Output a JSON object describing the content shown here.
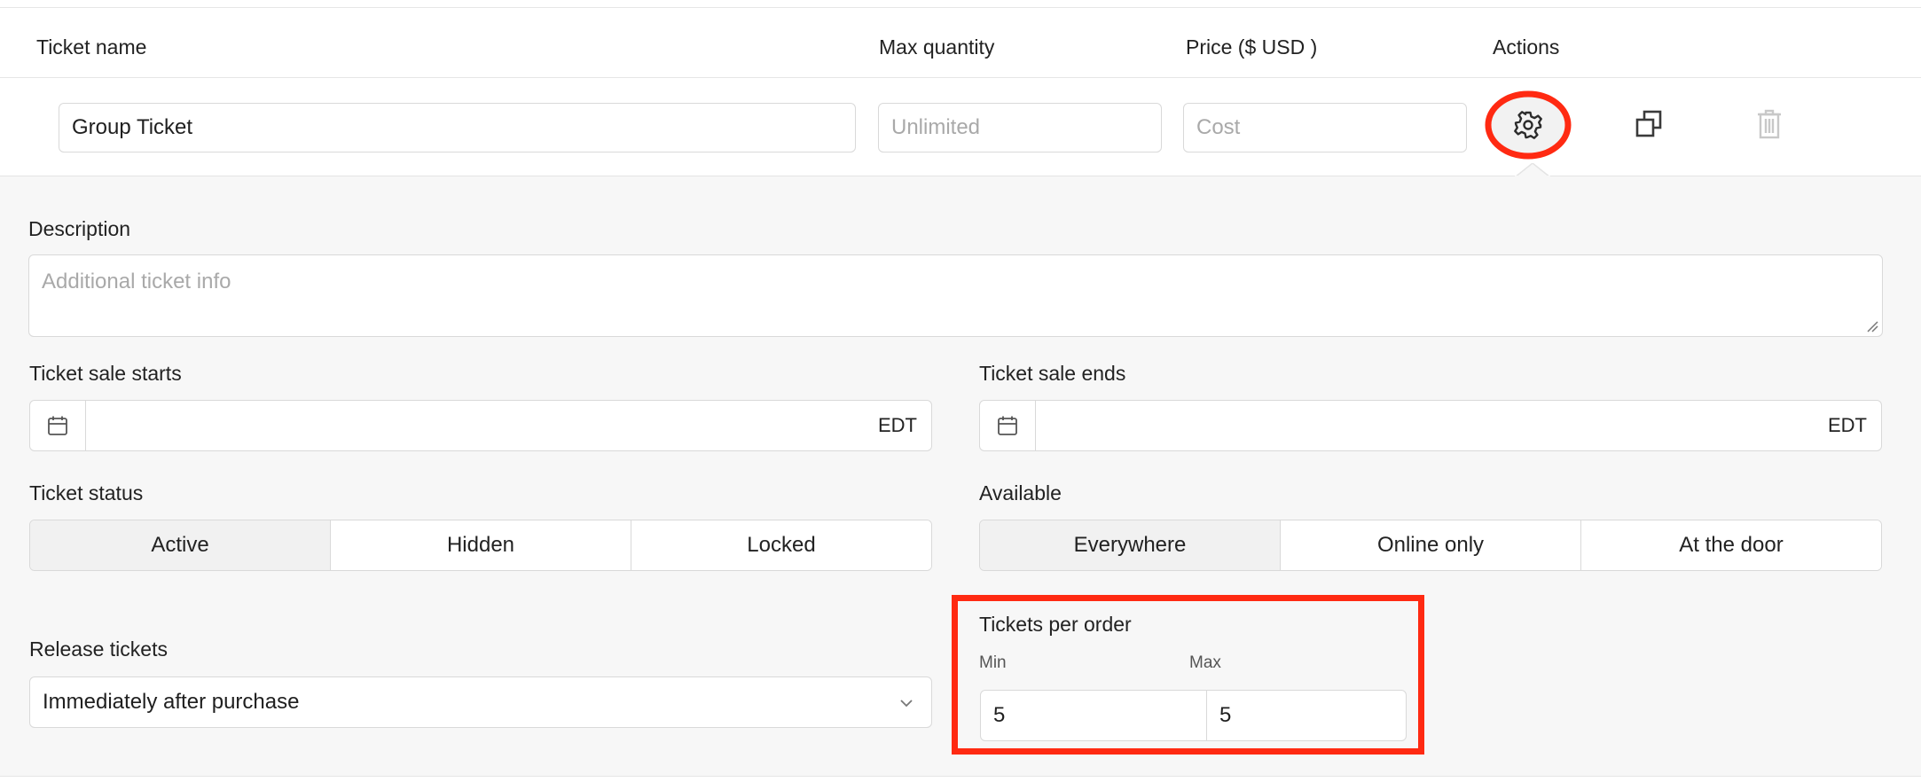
{
  "columns": {
    "ticket_name": "Ticket name",
    "max_quantity": "Max quantity",
    "price": "Price ($ USD )",
    "actions": "Actions"
  },
  "ticket_row": {
    "name_value": "Group Ticket",
    "max_quantity_placeholder": "Unlimited",
    "cost_placeholder": "Cost",
    "action_icons": [
      "gear-icon",
      "duplicate-icon",
      "trash-icon"
    ]
  },
  "settings": {
    "description_label": "Description",
    "description_placeholder": "Additional ticket info",
    "sale_starts_label": "Ticket sale starts",
    "sale_starts_tz": "EDT",
    "sale_ends_label": "Ticket sale ends",
    "sale_ends_tz": "EDT",
    "status_label": "Ticket status",
    "status_options": [
      "Active",
      "Hidden",
      "Locked"
    ],
    "status_selected": "Active",
    "available_label": "Available",
    "available_options": [
      "Everywhere",
      "Online only",
      "At the door"
    ],
    "available_selected": "Everywhere",
    "release_label": "Release tickets",
    "release_value": "Immediately after purchase",
    "per_order_label": "Tickets per order",
    "min_label": "Min",
    "max_label": "Max",
    "min_value": "5",
    "max_value": "5"
  },
  "colors": {
    "highlight": "#ff2a12",
    "border": "#d9d9d9",
    "panel_bg": "#f7f7f7"
  }
}
